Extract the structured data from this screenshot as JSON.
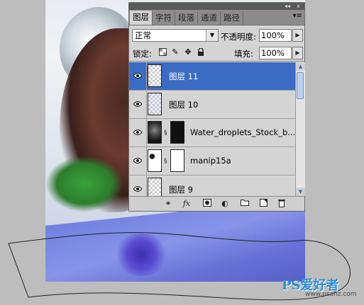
{
  "panel": {
    "tabs": [
      {
        "label": "图层",
        "active": true
      },
      {
        "label": "字符",
        "active": false
      },
      {
        "label": "段落",
        "active": false
      },
      {
        "label": "通道",
        "active": false
      },
      {
        "label": "路径",
        "active": false
      }
    ],
    "titlebar_collapse": "◂◂",
    "titlebar_close": "x",
    "menu_icon": "▾≡",
    "blend_mode": "正常",
    "opacity_label": "不透明度:",
    "opacity_value": "100%",
    "lock_label": "锁定:",
    "fill_label": "填充:",
    "fill_value": "100%"
  },
  "layers": [
    {
      "name": "图层 11",
      "selected": true
    },
    {
      "name": "图层 10",
      "selected": false
    },
    {
      "name": "Water_droplets_Stock_b...",
      "selected": false
    },
    {
      "name": "manip15a",
      "selected": false
    },
    {
      "name": "图层 9",
      "selected": false
    }
  ],
  "watermark": {
    "text": "PS爱好者",
    "url": "www.psahz.com"
  },
  "colors": {
    "selection": "#3a6cc4",
    "panel_bg": "#d4d4d4",
    "tab_bar": "#8c8c8c"
  }
}
